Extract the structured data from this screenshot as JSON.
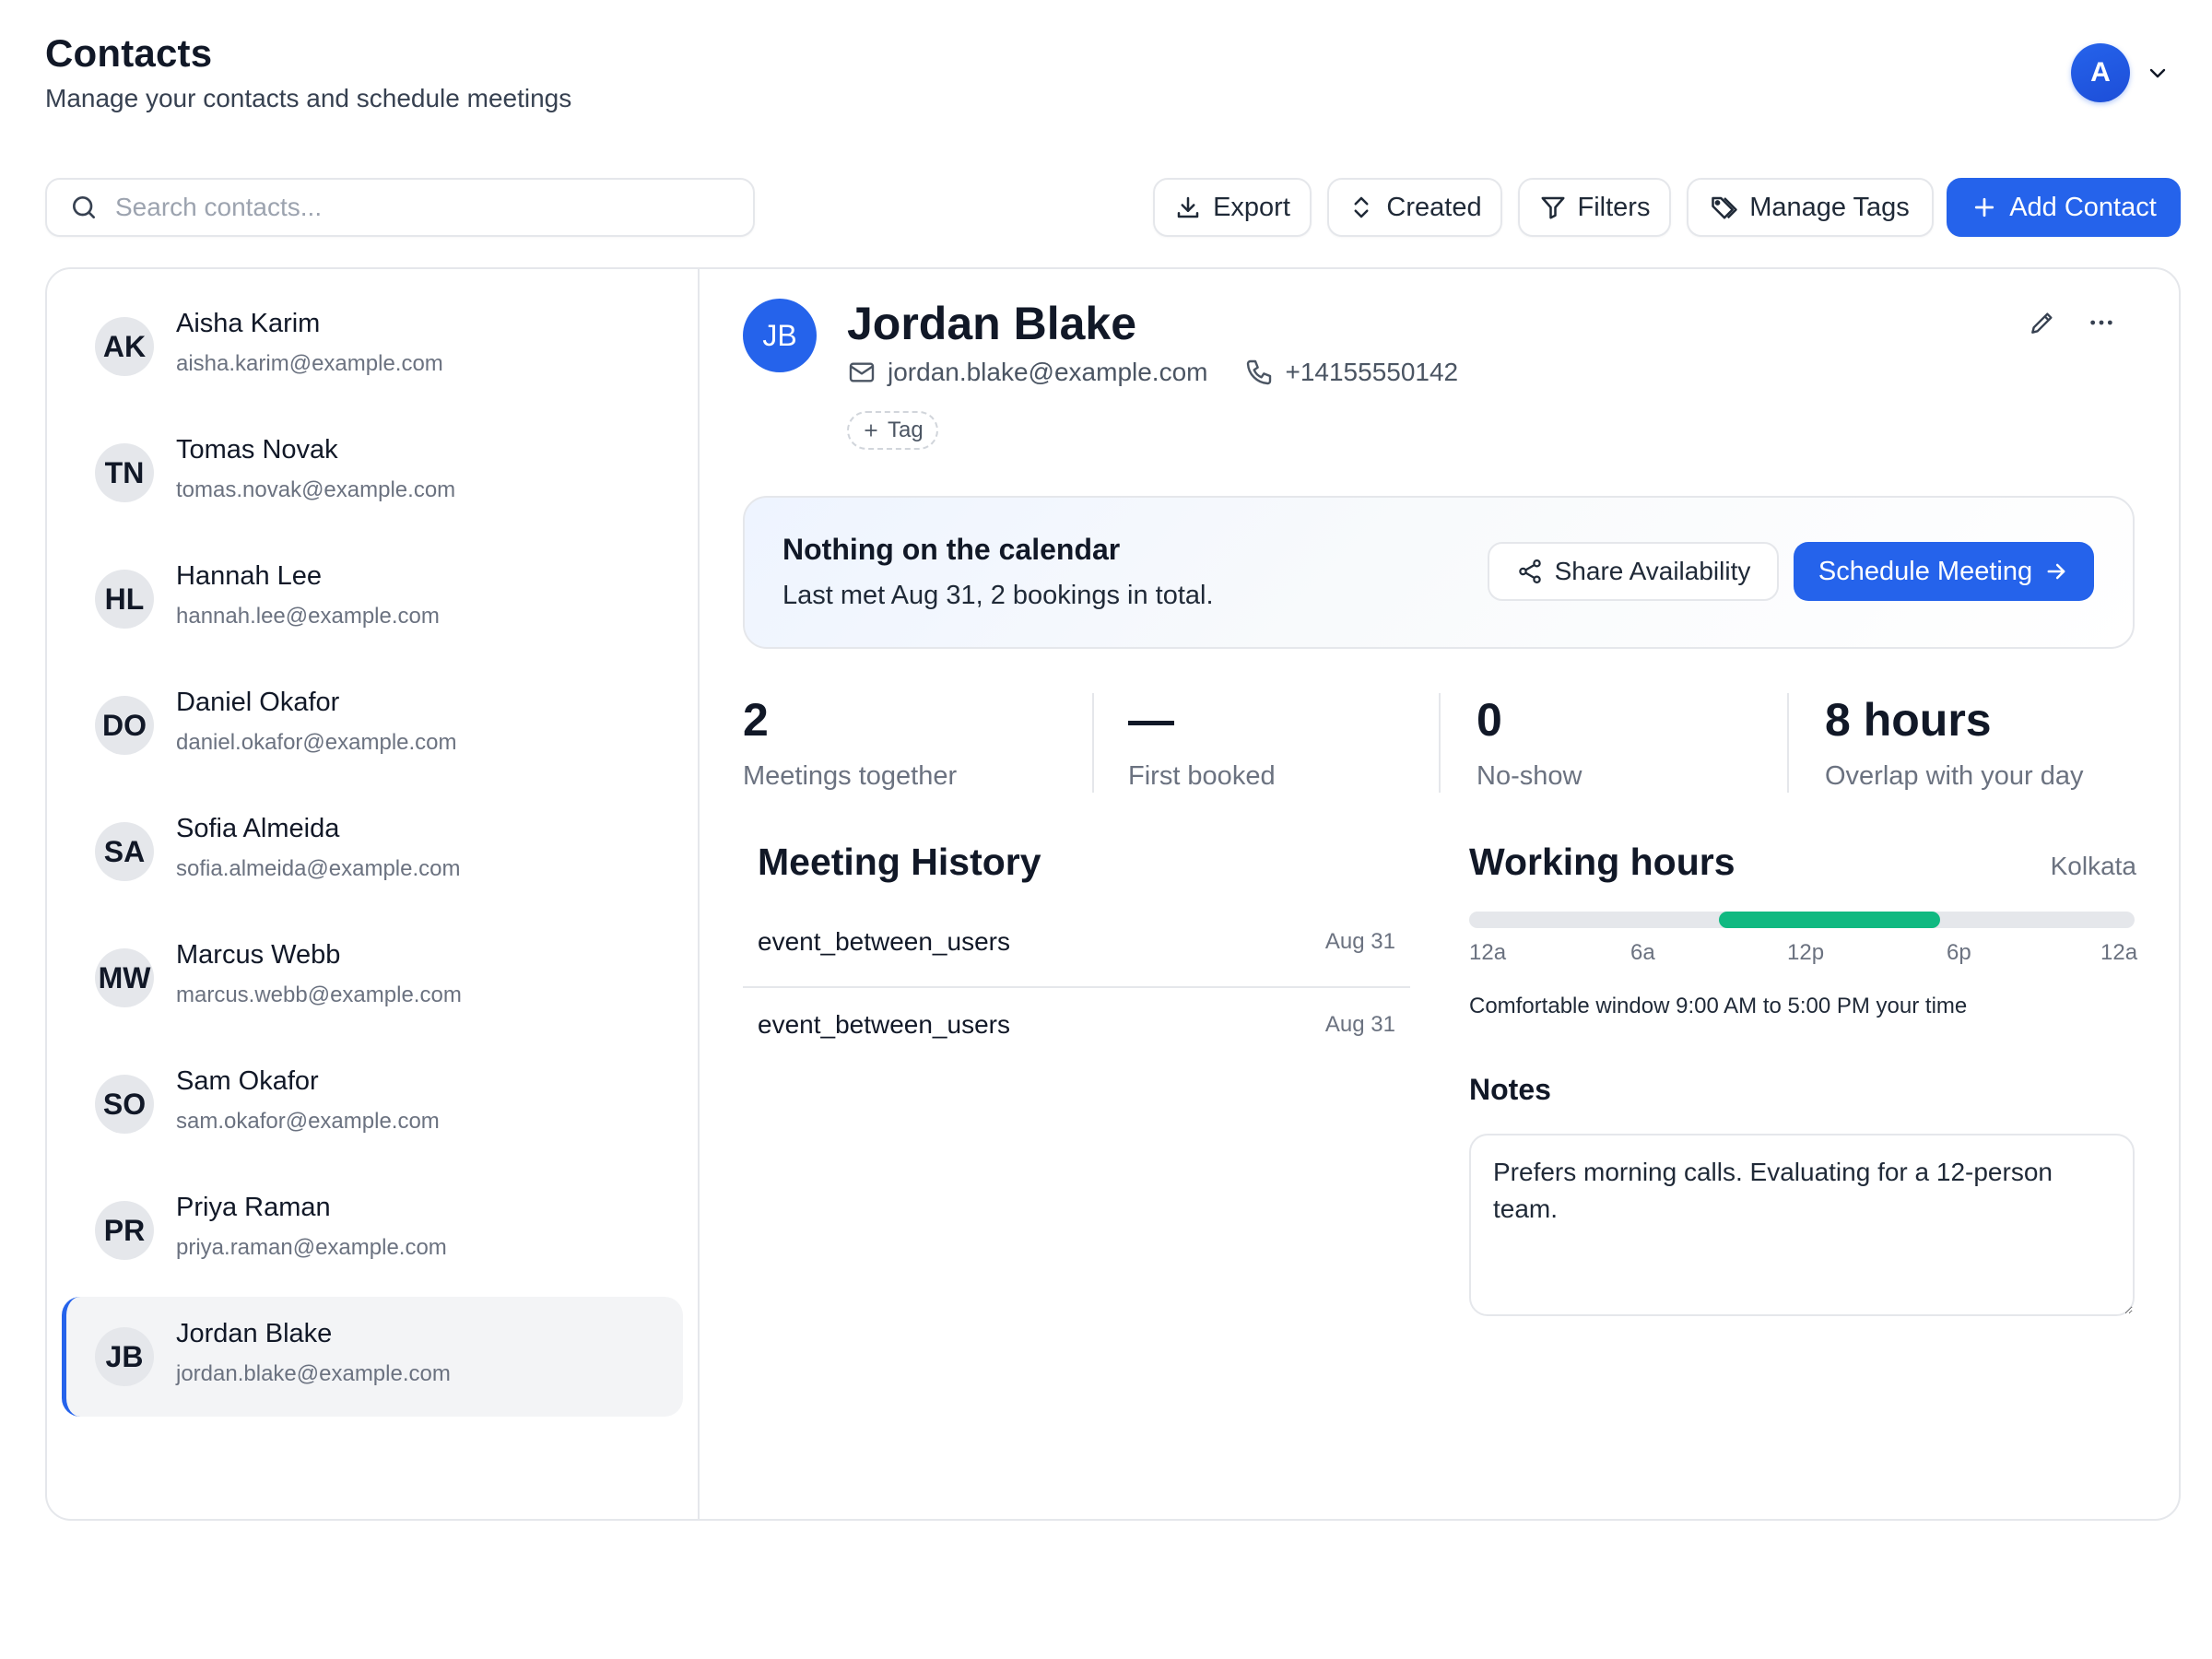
{
  "header": {
    "title": "Contacts",
    "subtitle": "Manage your contacts and schedule meetings",
    "user_initial": "A"
  },
  "toolbar": {
    "search_placeholder": "Search contacts...",
    "export_label": "Export",
    "sort_label": "Created",
    "filters_label": "Filters",
    "manage_tags_label": "Manage Tags",
    "add_contact_label": "Add Contact"
  },
  "contacts": [
    {
      "initials": "AK",
      "name": "Aisha Karim",
      "email": "aisha.karim@example.com"
    },
    {
      "initials": "TN",
      "name": "Tomas Novak",
      "email": "tomas.novak@example.com"
    },
    {
      "initials": "HL",
      "name": "Hannah Lee",
      "email": "hannah.lee@example.com"
    },
    {
      "initials": "DO",
      "name": "Daniel Okafor",
      "email": "daniel.okafor@example.com"
    },
    {
      "initials": "SA",
      "name": "Sofia Almeida",
      "email": "sofia.almeida@example.com"
    },
    {
      "initials": "MW",
      "name": "Marcus Webb",
      "email": "marcus.webb@example.com"
    },
    {
      "initials": "SO",
      "name": "Sam Okafor",
      "email": "sam.okafor@example.com"
    },
    {
      "initials": "PR",
      "name": "Priya Raman",
      "email": "priya.raman@example.com"
    },
    {
      "initials": "JB",
      "name": "Jordan Blake",
      "email": "jordan.blake@example.com"
    }
  ],
  "selected": {
    "initials": "JB",
    "name": "Jordan Blake",
    "email": "jordan.blake@example.com",
    "phone": "+14155550142",
    "tag_label": "Tag",
    "calendar": {
      "title": "Nothing on the calendar",
      "subtitle": "Last met Aug 31, 2 bookings in total.",
      "share_label": "Share Availability",
      "schedule_label": "Schedule Meeting"
    },
    "stats": [
      {
        "value": "2",
        "label": "Meetings together"
      },
      {
        "value": "—",
        "label": "First booked"
      },
      {
        "value": "0",
        "label": "No-show"
      },
      {
        "value": "8 hours",
        "label": "Overlap with your day"
      }
    ],
    "meeting_history": {
      "title": "Meeting History",
      "items": [
        {
          "name": "event_between_users",
          "date": "Aug 31"
        },
        {
          "name": "event_between_users",
          "date": "Aug 31"
        }
      ]
    },
    "working_hours": {
      "title": "Working hours",
      "timezone": "Kolkata",
      "ticks": [
        "12a",
        "6a",
        "12p",
        "6p",
        "12a"
      ],
      "window_start_fraction": 0.375,
      "window_end_fraction": 0.708,
      "comfort_text": "Comfortable window 9:00 AM to 5:00 PM your time"
    },
    "notes": {
      "label": "Notes",
      "text": "Prefers morning calls. Evaluating for a 12-person team."
    }
  },
  "colors": {
    "accent": "#2563eb",
    "working_window": "#10b981",
    "border": "#e5e7eb"
  }
}
